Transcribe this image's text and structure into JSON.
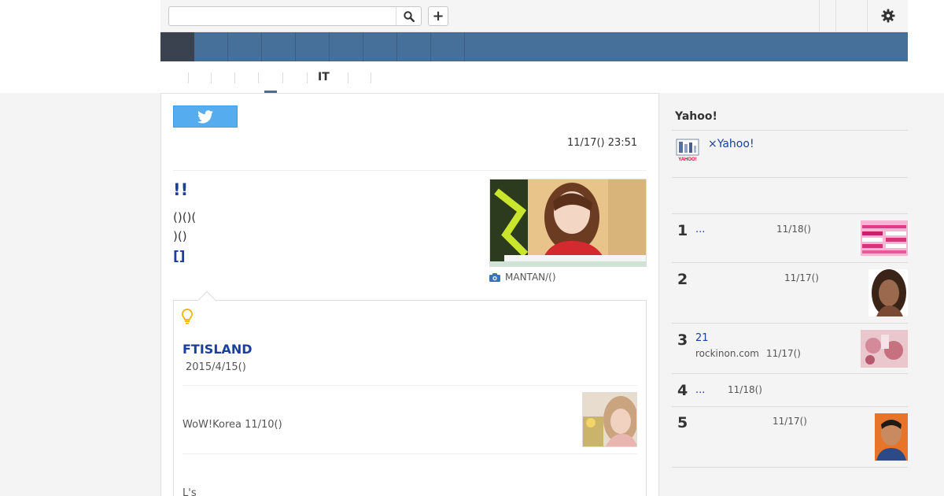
{
  "search": {
    "placeholder": "",
    "value": ""
  },
  "toolbar": {
    "plus_label": "+"
  },
  "subnav": {
    "active_label": "IT"
  },
  "article": {
    "datetime": "11/17() 23:51",
    "headline": "!!",
    "lede_line1": "()()(",
    "lede_line2": ")()",
    "lede_line3": "[]",
    "photo_caption": "MANTAN/()"
  },
  "related": {
    "title": "FTISLAND",
    "date": "2015/4/15()",
    "source": "WoW!Korea 11/10()",
    "next_label": "L's"
  },
  "sidebar": {
    "title": "Yahoo!",
    "promo_link": "×Yahoo!",
    "logo_label": "YAHOO!",
    "ranking": [
      {
        "num": "1",
        "link": "...",
        "source": "",
        "date": "11/18()"
      },
      {
        "num": "2",
        "link": "",
        "source": "",
        "date": "11/17()"
      },
      {
        "num": "3",
        "link": "21",
        "source": "rockinon.com",
        "date": "11/17()"
      },
      {
        "num": "4",
        "link": "...",
        "source": "",
        "date": "11/18()"
      },
      {
        "num": "5",
        "link": "",
        "source": "",
        "date": "11/17()"
      }
    ]
  },
  "colors": {
    "nav_bg": "#467099",
    "nav_active": "#3a4250",
    "link": "#1a3fa0",
    "twitter": "#55acee"
  },
  "icons": [
    "search-icon",
    "plus-icon",
    "gear-icon",
    "twitter-icon",
    "camera-icon",
    "lightbulb-icon"
  ]
}
